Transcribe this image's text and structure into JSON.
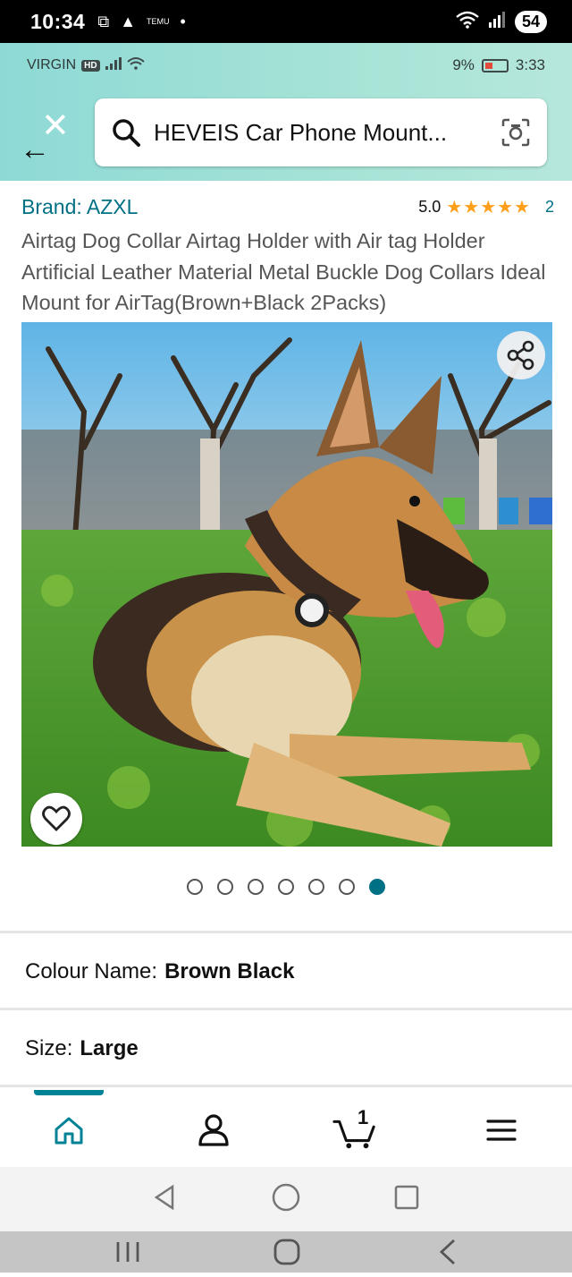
{
  "outer_status": {
    "time": "10:34",
    "icons": [
      "screenshot-icon",
      "app-icon",
      "temu-icon",
      "dot-icon"
    ],
    "mini_label": "TEMU",
    "battery": "54"
  },
  "inner_status": {
    "carrier": "VIRGIN",
    "hd": "HD",
    "battery_percent": "9%",
    "time": "3:33"
  },
  "search": {
    "query": "HEVEIS Car Phone Mount..."
  },
  "product": {
    "brand_label": "Brand: AZXL",
    "rating_value": "5.0",
    "stars": "★★★★★",
    "rating_count": "2",
    "title": "Airtag Dog Collar Airtag Holder with Air tag Holder Artificial Leather Material Metal Buckle Dog Collars Ideal Mount for AirTag(Brown+Black 2Packs)",
    "image_count": 7,
    "active_image_index": 6
  },
  "options": {
    "colour_label": "Colour Name:",
    "colour_value": "Brown Black",
    "size_label": "Size:",
    "size_value": "Large"
  },
  "tabbar": {
    "cart_count": "1"
  },
  "colors": {
    "accent": "#007185",
    "header_gradient_start": "#8ed9d6",
    "star": "#ff9f1a"
  }
}
